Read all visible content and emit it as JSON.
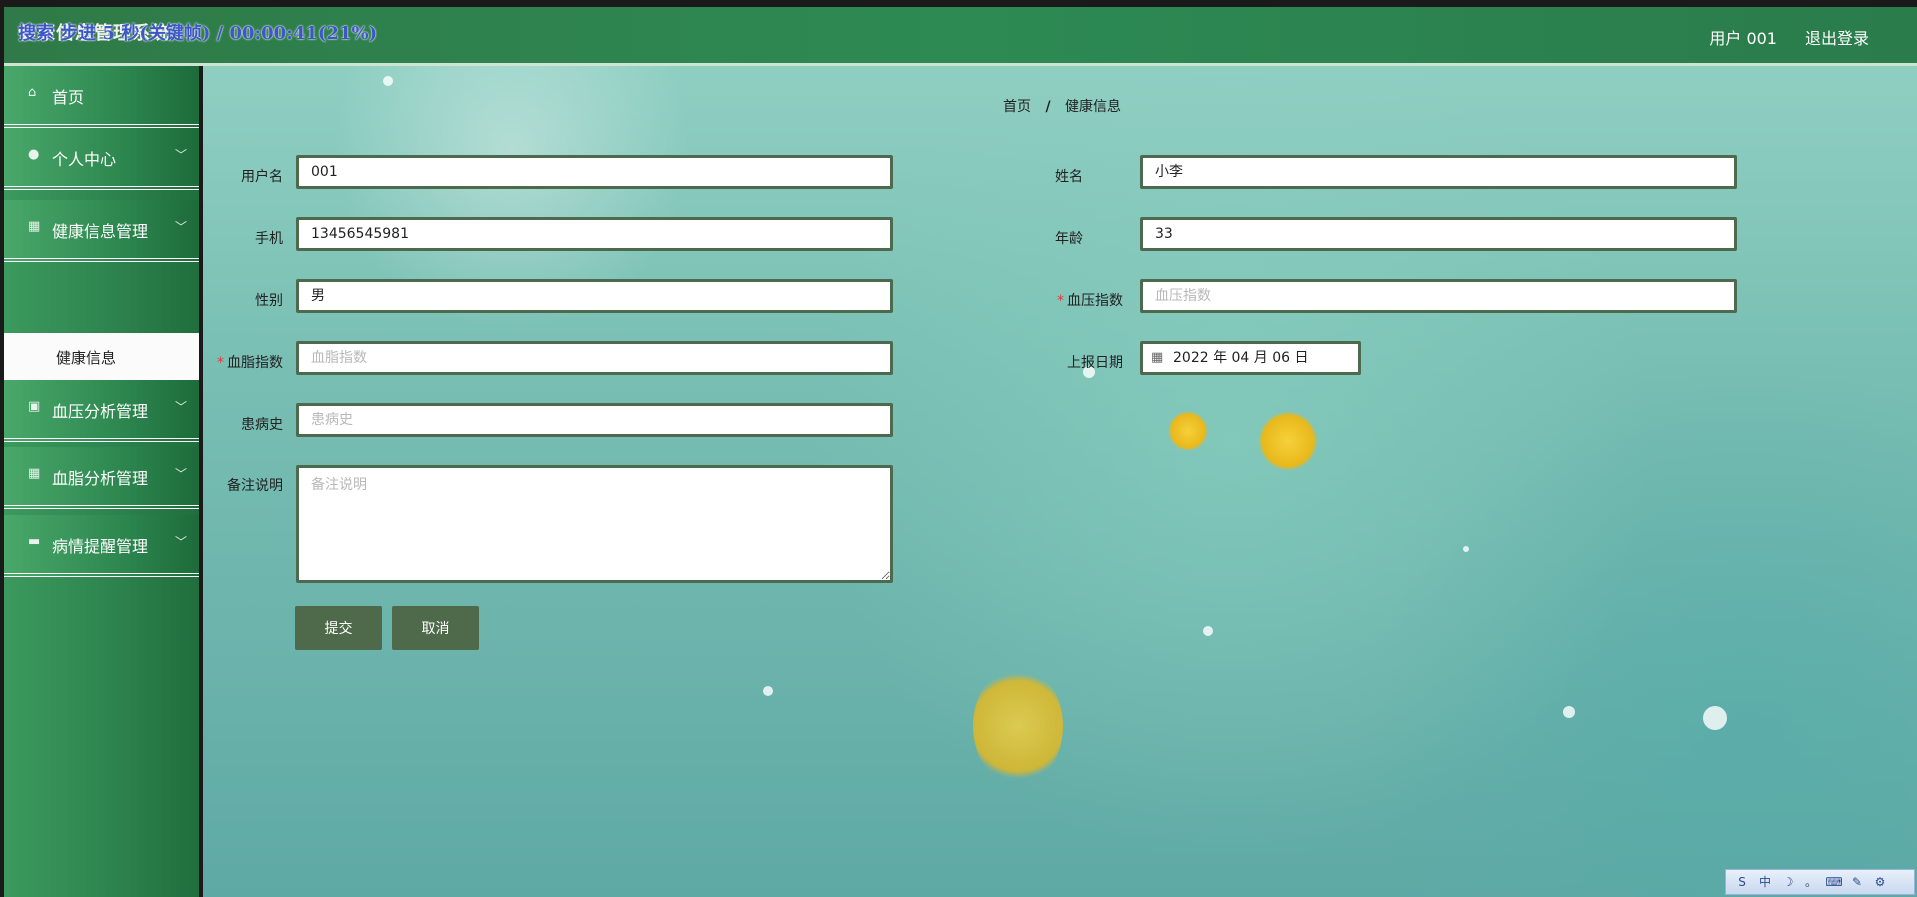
{
  "header": {
    "brand": "健康信息管理系统",
    "overlay_text": "搜索 步进 5 秒(关键帧) / 00:00:41(21%)",
    "user_label": "用户 001",
    "logout_label": "退出登录"
  },
  "sidebar": {
    "items": [
      {
        "label": "首页",
        "icon": "home-icon"
      },
      {
        "label": "个人中心",
        "icon": "user-icon"
      },
      {
        "label": "健康信息管理",
        "icon": "grid-icon"
      },
      {
        "label": "血压分析管理",
        "icon": "clipboard-icon"
      },
      {
        "label": "血脂分析管理",
        "icon": "grid-icon"
      },
      {
        "label": "病情提醒管理",
        "icon": "monitor-icon"
      }
    ],
    "sub_item": "健康信息"
  },
  "breadcrumb": {
    "home": "首页",
    "separator": "/",
    "current": "健康信息"
  },
  "form": {
    "username": {
      "label": "用户名",
      "value": "001"
    },
    "name": {
      "label": "姓名",
      "value": "小李"
    },
    "phone": {
      "label": "手机",
      "value": "13456545981"
    },
    "age": {
      "label": "年龄",
      "value": "33"
    },
    "gender": {
      "label": "性别",
      "value": "男"
    },
    "blood_pressure": {
      "label": "血压指数",
      "placeholder": "血压指数",
      "required_mark": "*"
    },
    "blood_lipid": {
      "label": "血脂指数",
      "placeholder": "血脂指数",
      "required_mark": "*"
    },
    "report_date": {
      "label": "上报日期",
      "value": "2022 年 04 月 06 日"
    },
    "history": {
      "label": "患病史",
      "placeholder": "患病史"
    },
    "remarks": {
      "label": "备注说明",
      "placeholder": "备注说明"
    },
    "submit_label": "提交",
    "cancel_label": "取消"
  },
  "ime_toolbar": [
    "中",
    "☽",
    "。",
    "⌨",
    "✎",
    "⚙"
  ]
}
